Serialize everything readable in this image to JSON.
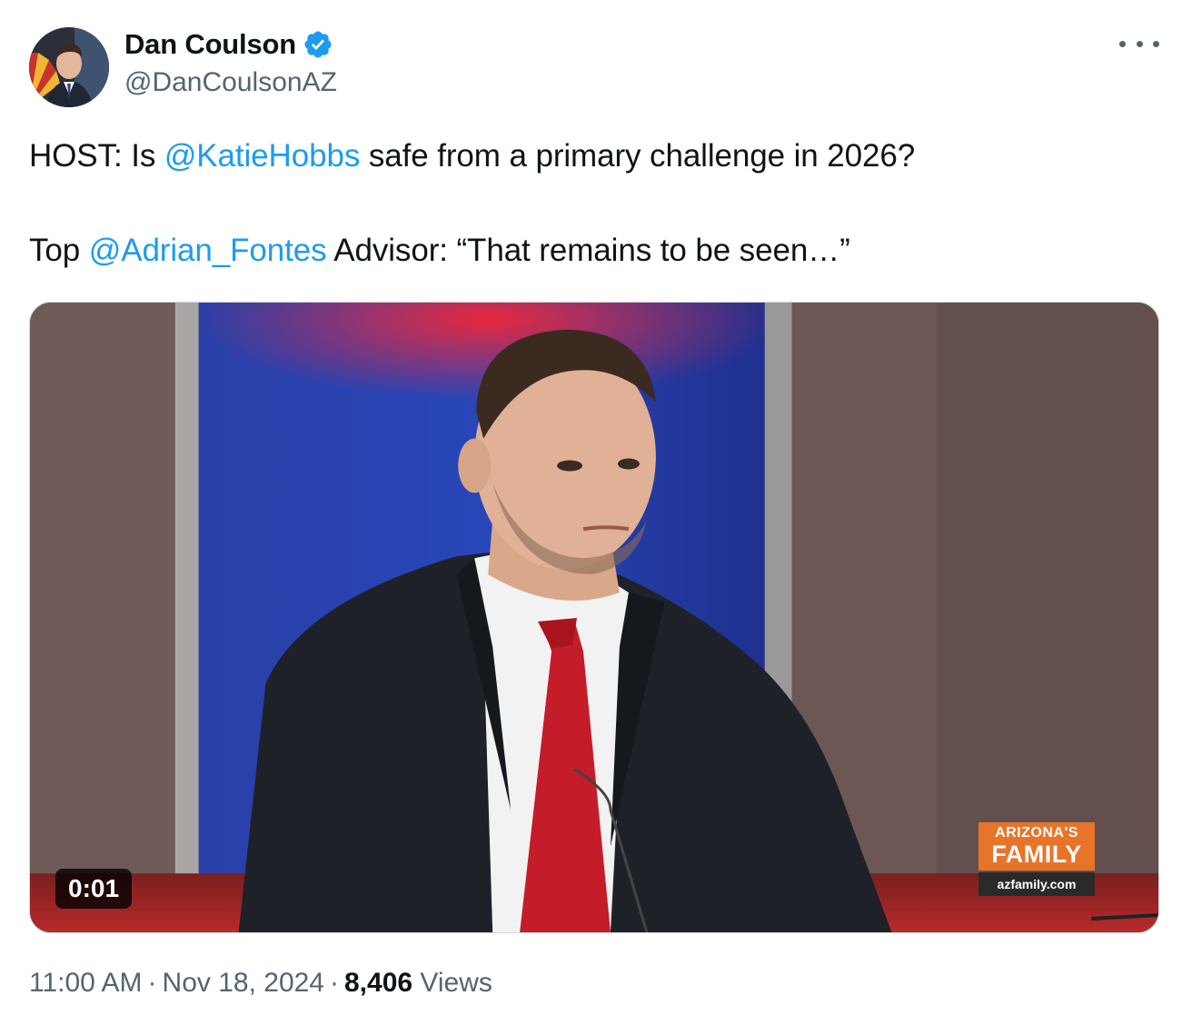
{
  "author": {
    "name": "Dan Coulson",
    "handle": "@DanCoulsonAZ",
    "verified": true,
    "verified_icon": "verified-badge-icon",
    "avatar_icon": "profile-avatar"
  },
  "more_icon": "more-horizontal-icon",
  "tweet": {
    "line1": {
      "before": "HOST: Is ",
      "mention": "@KatieHobbs",
      "after": " safe from a primary challenge in 2026?"
    },
    "line2": {
      "before": "Top ",
      "mention": "@Adrian_Fontes",
      "after": " Advisor: “That remains to be seen…”"
    }
  },
  "media": {
    "type": "video",
    "timer": "0:01",
    "channel_logo": {
      "line1": "ARIZONA'S",
      "line2": "FAMILY",
      "url": "azfamily.com"
    }
  },
  "meta": {
    "time": "11:00 AM",
    "separator": "·",
    "date": "Nov 18, 2024",
    "views_count": "8,406",
    "views_label": "Views"
  },
  "colors": {
    "accent": "#1d9bf0",
    "text": "#0f1419",
    "secondary": "#536471",
    "logo_orange": "#e8742a"
  }
}
